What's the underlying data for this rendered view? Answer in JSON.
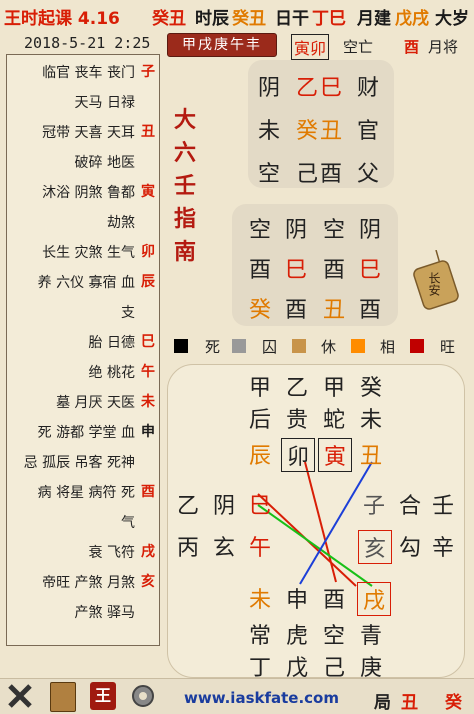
{
  "topbar": {
    "left": "王时起课 4.16",
    "items": [
      {
        "text": "大岁",
        "c": "blk"
      },
      {
        "text": "戊戌",
        "c": "org"
      },
      {
        "text": "月建",
        "c": "blk"
      },
      {
        "text": "丁巳",
        "c": "red"
      },
      {
        "text": "日干",
        "c": "blk"
      },
      {
        "text": "癸丑",
        "c": "org"
      },
      {
        "text": "时辰",
        "c": "blk"
      },
      {
        "text": "癸丑",
        "c": "red"
      }
    ]
  },
  "subheader": {
    "date": "2018-5-21 2:25",
    "sanchuan": "甲戌庚午丰",
    "month_general": "月将",
    "month_general_val": "酉",
    "kongwang": "空亡",
    "kongwang_val": "寅卯"
  },
  "left_rows": [
    {
      "g": "子",
      "t": "临官 丧车 丧门",
      "gc": "red"
    },
    {
      "g": "",
      "t": "天马 日禄"
    },
    {
      "g": "丑",
      "t": "冠带 天喜 天耳",
      "gc": "red"
    },
    {
      "g": "",
      "t": "破碎 地医"
    },
    {
      "g": "寅",
      "t": "沐浴 阴煞 鲁都",
      "gc": "red"
    },
    {
      "g": "",
      "t": "劫煞"
    },
    {
      "g": "卯",
      "t": "长生 灾煞 生气",
      "gc": "red"
    },
    {
      "g": "辰",
      "t": "养 六仪 寡宿 血",
      "gc": "red"
    },
    {
      "g": "",
      "t": "支"
    },
    {
      "g": "巳",
      "t": "胎 日德",
      "gc": "red"
    },
    {
      "g": "午",
      "t": "绝 桃花",
      "gc": "red"
    },
    {
      "g": "未",
      "t": "墓 月厌 天医",
      "gc": "red"
    },
    {
      "g": "申",
      "t": "死 游都 学堂 血",
      "gc": "blk"
    },
    {
      "g": "",
      "t": "忌 孤辰 吊客 死神"
    },
    {
      "g": "酉",
      "t": "病 将星 病符 死",
      "gc": "red"
    },
    {
      "g": "",
      "t": "气"
    },
    {
      "g": "戌",
      "t": "衰 飞符",
      "gc": "red"
    },
    {
      "g": "亥",
      "t": "帝旺 产煞 月煞",
      "gc": "red"
    },
    {
      "g": "",
      "t": "产煞 驿马"
    }
  ],
  "vertical_text": "大六壬指南",
  "sanchuan_panel": [
    {
      "a": "财",
      "b": "乙巳",
      "c": "阴"
    },
    {
      "a": "官",
      "b": "癸丑",
      "c": "未"
    },
    {
      "a": "父",
      "b": "己酉",
      "c": "空"
    }
  ],
  "sike": {
    "row1": [
      "阴",
      "空",
      "阴",
      "空"
    ],
    "row2": [
      "巳",
      "酉",
      "巳",
      "酉"
    ],
    "row3": [
      "酉",
      "丑",
      "酉",
      "癸"
    ]
  },
  "legend": [
    {
      "label": "旺",
      "color": "#c00000"
    },
    {
      "label": "相",
      "color": "#ff8c00"
    },
    {
      "label": "休",
      "color": "#c8944a"
    },
    {
      "label": "囚",
      "color": "#999999"
    },
    {
      "label": "死",
      "color": "#000000"
    }
  ],
  "tianpan": {
    "top1": [
      "癸",
      "甲",
      "乙",
      "甲"
    ],
    "top2": [
      "未",
      "蛇",
      "贵",
      "后"
    ],
    "top3": [
      "丑",
      "寅",
      "卯",
      "辰"
    ],
    "left": [
      "壬",
      "合",
      "子"
    ],
    "left2": [
      "辛",
      "勾",
      "亥"
    ],
    "right": [
      "巳",
      "阴",
      "乙"
    ],
    "right2": [
      "午",
      "玄",
      "丙"
    ],
    "bottom3": [
      "戌",
      "酉",
      "申",
      "未"
    ],
    "bottom2": [
      "青",
      "空",
      "虎",
      "常"
    ],
    "bottom1": [
      "庚",
      "己",
      "戊",
      "丁"
    ]
  },
  "tag": "长安",
  "bottombar": {
    "ju": "局",
    "ju_val": "丑",
    "ju_prefix": "癸",
    "site": "www.iaskfate.com"
  }
}
